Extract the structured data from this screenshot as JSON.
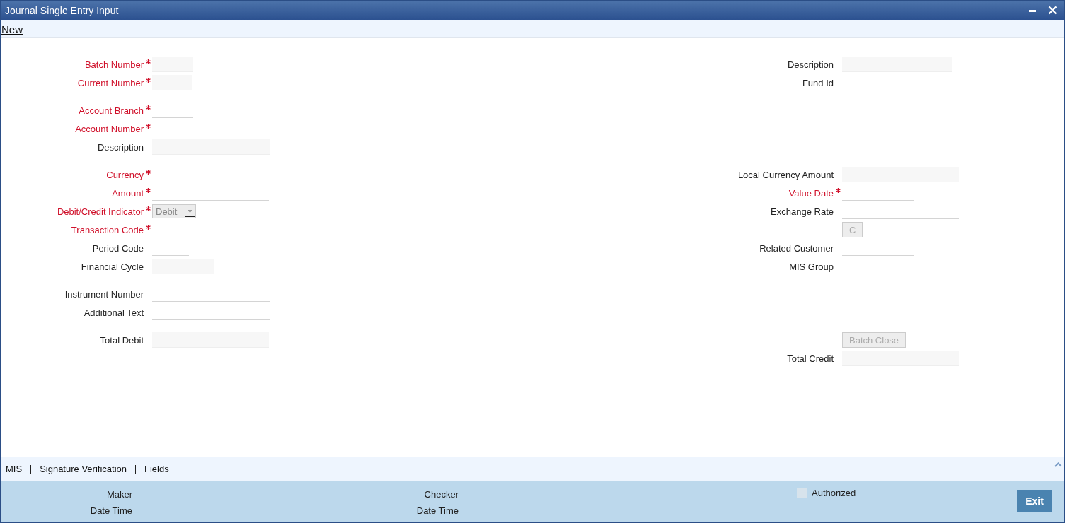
{
  "window": {
    "title": "Journal Single Entry Input"
  },
  "toolbar": {
    "link": "New"
  },
  "sections": [
    {
      "rows": [
        {
          "left": {
            "label": "Batch Number",
            "required": true,
            "kind": "readonly"
          },
          "right": {
            "label": "Description",
            "required": false,
            "kind": "readonly"
          }
        },
        {
          "left": {
            "label": "Current Number",
            "required": true,
            "kind": "readonly"
          },
          "right": {
            "label": "Fund Id",
            "required": false,
            "kind": "text"
          }
        }
      ]
    },
    {
      "rows": [
        {
          "left": {
            "label": "Account Branch",
            "required": true,
            "kind": "text"
          }
        },
        {
          "left": {
            "label": "Account Number",
            "required": true,
            "kind": "text"
          }
        },
        {
          "left": {
            "label": "Description",
            "required": false,
            "kind": "readonly"
          }
        }
      ]
    },
    {
      "rows": [
        {
          "left": {
            "label": "Currency",
            "required": true,
            "kind": "text"
          },
          "right": {
            "label": "Local Currency Amount",
            "required": false,
            "kind": "readonly"
          }
        },
        {
          "left": {
            "label": "Amount",
            "required": true,
            "kind": "text"
          },
          "right": {
            "label": "Value Date",
            "required": true,
            "kind": "text"
          }
        },
        {
          "left": {
            "label": "Debit/Credit Indicator",
            "required": true,
            "kind": "select",
            "value": "Debit",
            "disabled": true
          },
          "right": {
            "label": "Exchange Rate",
            "required": false,
            "kind": "text"
          }
        },
        {
          "left": {
            "label": "Transaction Code",
            "required": true,
            "kind": "text"
          },
          "right": {
            "kind": "button",
            "text": "C",
            "disabled": true
          }
        },
        {
          "left": {
            "label": "Period Code",
            "required": false,
            "kind": "text"
          },
          "right": {
            "label": "Related Customer",
            "required": false,
            "kind": "text"
          }
        },
        {
          "left": {
            "label": "Financial Cycle",
            "required": false,
            "kind": "readonly"
          },
          "right": {
            "label": "MIS Group",
            "required": false,
            "kind": "text"
          }
        }
      ]
    },
    {
      "rows": [
        {
          "left": {
            "label": "Instrument Number",
            "required": false,
            "kind": "text"
          }
        },
        {
          "left": {
            "label": "Additional Text",
            "required": false,
            "kind": "text"
          }
        }
      ]
    },
    {
      "rows": [
        {
          "left": {
            "label": "Total Debit",
            "required": false,
            "kind": "readonly"
          },
          "right": {
            "kind": "button",
            "text": "Batch Close",
            "disabled": true
          }
        },
        {
          "right": {
            "label": "Total Credit",
            "required": false,
            "kind": "readonly"
          }
        }
      ]
    }
  ],
  "footer_tabs": [
    "MIS",
    "Signature Verification",
    "Fields"
  ],
  "audit": {
    "maker": "Maker",
    "maker_date": "Date Time",
    "checker": "Checker",
    "checker_date": "Date Time",
    "authorized": {
      "label": "Authorized",
      "checked": false
    },
    "exit": "Exit"
  }
}
